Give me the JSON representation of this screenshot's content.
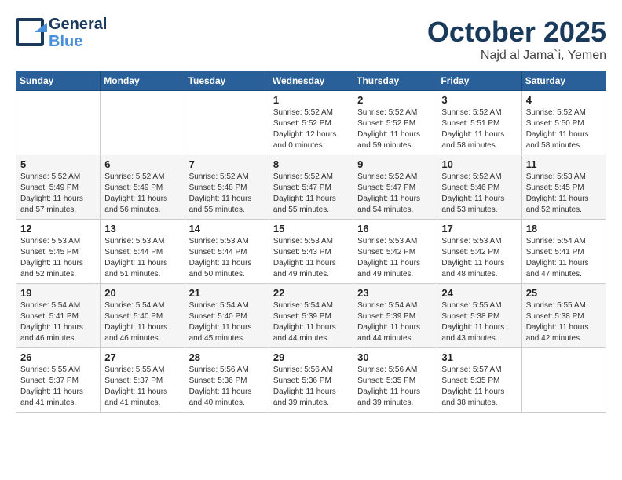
{
  "logo": {
    "line1": "General",
    "line2": "Blue"
  },
  "title": "October 2025",
  "location": "Najd al Jama`i, Yemen",
  "days_of_week": [
    "Sunday",
    "Monday",
    "Tuesday",
    "Wednesday",
    "Thursday",
    "Friday",
    "Saturday"
  ],
  "weeks": [
    [
      {
        "day": "",
        "details": ""
      },
      {
        "day": "",
        "details": ""
      },
      {
        "day": "",
        "details": ""
      },
      {
        "day": "1",
        "details": "Sunrise: 5:52 AM\nSunset: 5:52 PM\nDaylight: 12 hours\nand 0 minutes."
      },
      {
        "day": "2",
        "details": "Sunrise: 5:52 AM\nSunset: 5:52 PM\nDaylight: 11 hours\nand 59 minutes."
      },
      {
        "day": "3",
        "details": "Sunrise: 5:52 AM\nSunset: 5:51 PM\nDaylight: 11 hours\nand 58 minutes."
      },
      {
        "day": "4",
        "details": "Sunrise: 5:52 AM\nSunset: 5:50 PM\nDaylight: 11 hours\nand 58 minutes."
      }
    ],
    [
      {
        "day": "5",
        "details": "Sunrise: 5:52 AM\nSunset: 5:49 PM\nDaylight: 11 hours\nand 57 minutes."
      },
      {
        "day": "6",
        "details": "Sunrise: 5:52 AM\nSunset: 5:49 PM\nDaylight: 11 hours\nand 56 minutes."
      },
      {
        "day": "7",
        "details": "Sunrise: 5:52 AM\nSunset: 5:48 PM\nDaylight: 11 hours\nand 55 minutes."
      },
      {
        "day": "8",
        "details": "Sunrise: 5:52 AM\nSunset: 5:47 PM\nDaylight: 11 hours\nand 55 minutes."
      },
      {
        "day": "9",
        "details": "Sunrise: 5:52 AM\nSunset: 5:47 PM\nDaylight: 11 hours\nand 54 minutes."
      },
      {
        "day": "10",
        "details": "Sunrise: 5:52 AM\nSunset: 5:46 PM\nDaylight: 11 hours\nand 53 minutes."
      },
      {
        "day": "11",
        "details": "Sunrise: 5:53 AM\nSunset: 5:45 PM\nDaylight: 11 hours\nand 52 minutes."
      }
    ],
    [
      {
        "day": "12",
        "details": "Sunrise: 5:53 AM\nSunset: 5:45 PM\nDaylight: 11 hours\nand 52 minutes."
      },
      {
        "day": "13",
        "details": "Sunrise: 5:53 AM\nSunset: 5:44 PM\nDaylight: 11 hours\nand 51 minutes."
      },
      {
        "day": "14",
        "details": "Sunrise: 5:53 AM\nSunset: 5:44 PM\nDaylight: 11 hours\nand 50 minutes."
      },
      {
        "day": "15",
        "details": "Sunrise: 5:53 AM\nSunset: 5:43 PM\nDaylight: 11 hours\nand 49 minutes."
      },
      {
        "day": "16",
        "details": "Sunrise: 5:53 AM\nSunset: 5:42 PM\nDaylight: 11 hours\nand 49 minutes."
      },
      {
        "day": "17",
        "details": "Sunrise: 5:53 AM\nSunset: 5:42 PM\nDaylight: 11 hours\nand 48 minutes."
      },
      {
        "day": "18",
        "details": "Sunrise: 5:54 AM\nSunset: 5:41 PM\nDaylight: 11 hours\nand 47 minutes."
      }
    ],
    [
      {
        "day": "19",
        "details": "Sunrise: 5:54 AM\nSunset: 5:41 PM\nDaylight: 11 hours\nand 46 minutes."
      },
      {
        "day": "20",
        "details": "Sunrise: 5:54 AM\nSunset: 5:40 PM\nDaylight: 11 hours\nand 46 minutes."
      },
      {
        "day": "21",
        "details": "Sunrise: 5:54 AM\nSunset: 5:40 PM\nDaylight: 11 hours\nand 45 minutes."
      },
      {
        "day": "22",
        "details": "Sunrise: 5:54 AM\nSunset: 5:39 PM\nDaylight: 11 hours\nand 44 minutes."
      },
      {
        "day": "23",
        "details": "Sunrise: 5:54 AM\nSunset: 5:39 PM\nDaylight: 11 hours\nand 44 minutes."
      },
      {
        "day": "24",
        "details": "Sunrise: 5:55 AM\nSunset: 5:38 PM\nDaylight: 11 hours\nand 43 minutes."
      },
      {
        "day": "25",
        "details": "Sunrise: 5:55 AM\nSunset: 5:38 PM\nDaylight: 11 hours\nand 42 minutes."
      }
    ],
    [
      {
        "day": "26",
        "details": "Sunrise: 5:55 AM\nSunset: 5:37 PM\nDaylight: 11 hours\nand 41 minutes."
      },
      {
        "day": "27",
        "details": "Sunrise: 5:55 AM\nSunset: 5:37 PM\nDaylight: 11 hours\nand 41 minutes."
      },
      {
        "day": "28",
        "details": "Sunrise: 5:56 AM\nSunset: 5:36 PM\nDaylight: 11 hours\nand 40 minutes."
      },
      {
        "day": "29",
        "details": "Sunrise: 5:56 AM\nSunset: 5:36 PM\nDaylight: 11 hours\nand 39 minutes."
      },
      {
        "day": "30",
        "details": "Sunrise: 5:56 AM\nSunset: 5:35 PM\nDaylight: 11 hours\nand 39 minutes."
      },
      {
        "day": "31",
        "details": "Sunrise: 5:57 AM\nSunset: 5:35 PM\nDaylight: 11 hours\nand 38 minutes."
      },
      {
        "day": "",
        "details": ""
      }
    ]
  ]
}
